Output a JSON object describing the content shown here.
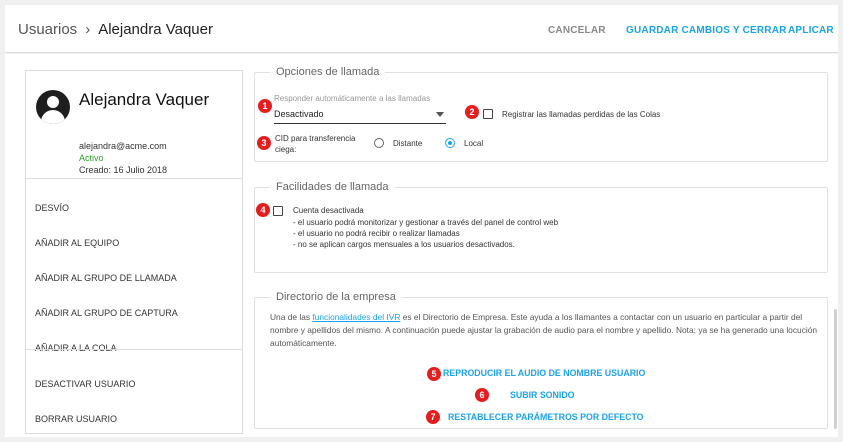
{
  "header": {
    "breadcrumb_root": "Usuarios",
    "breadcrumb_sep": "›",
    "breadcrumb_current": "Alejandra Vaquer",
    "cancel_label": "CANCELAR",
    "save_close_label": "GUARDAR CAMBIOS Y CERRAR",
    "apply_label": "APLICAR"
  },
  "profile": {
    "name": "Alejandra Vaquer",
    "email": "alejandra@acme.com",
    "status": "Activo",
    "created": "Creado: 16 Julio 2018"
  },
  "menu": {
    "items": [
      {
        "label": "DESVÍO"
      },
      {
        "label": "AÑADIR AL EQUIPO"
      },
      {
        "label": "AÑADIR AL GRUPO DE LLAMADA"
      },
      {
        "label": "AÑADIR AL GRUPO DE CAPTURA"
      },
      {
        "label": "AÑADIR A LA COLA"
      },
      {
        "label": "DESACTIVAR USUARIO"
      },
      {
        "label": "BORRAR USUARIO"
      }
    ]
  },
  "call_options": {
    "legend": "Opciones de llamada",
    "auto_answer_label": "Responder automáticamente a las llamadas",
    "auto_answer_value": "Desactivado",
    "register_missed_label": "Registrar las llamadas perdidas de las Colas",
    "register_missed_checked": false,
    "cid_label_line1": "CID para transferencia",
    "cid_label_line2": "ciega:",
    "cid_options": [
      {
        "label": "Distante",
        "selected": false
      },
      {
        "label": "Local",
        "selected": true
      }
    ]
  },
  "call_facilities": {
    "legend": "Facilidades de llamada",
    "account_disabled_label": "Cuenta desactivada",
    "account_disabled_checked": false,
    "notes": [
      "- el usuario podrá monitorizar y gestionar a través del panel de control web",
      "- el usuario no podrá recibir o realizar llamadas",
      "- no se aplican cargos mensuales a los usuarios desactivados."
    ]
  },
  "directory": {
    "legend": "Directorio de la empresa",
    "text_before_link": "Una de las ",
    "link_text": "funcionalidades del IVR",
    "text_after_link": " es el Directorio de Empresa. Este ayuda a los llamantes a contactar con un usuario en particular a partir del nombre y apellidos del mismo. A continuación puede ajustar la grabación de audio para el nombre y apellido. Nota: ya se ha generado una locución automáticamente.",
    "play_label": "REPRODUCIR EL AUDIO DE NOMBRE USUARIO",
    "upload_label": "SUBIR SONIDO",
    "reset_label": "RESTABLECER PARÁMETROS POR DEFECTO"
  },
  "badges": [
    "1",
    "2",
    "3",
    "4",
    "5",
    "6",
    "7"
  ],
  "colors": {
    "accent": "#1aa3e8",
    "badge": "#e41e1e",
    "status_active": "#2e9e2e"
  }
}
